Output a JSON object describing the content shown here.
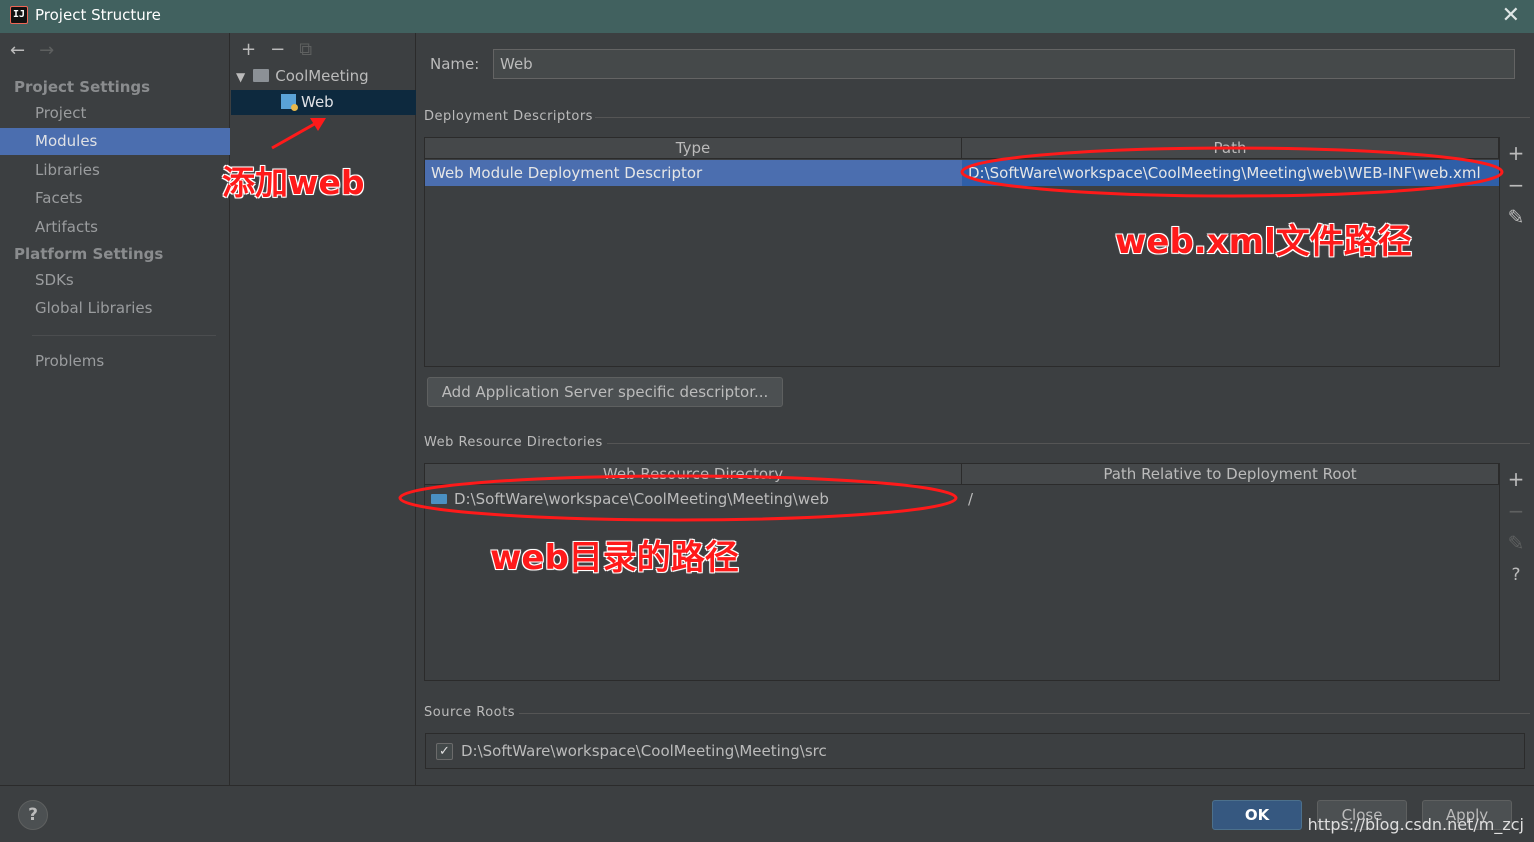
{
  "window": {
    "title": "Project Structure",
    "close_glyph": "✕",
    "app_icon_text": "IJ"
  },
  "nav": {
    "back": "←",
    "forward": "→"
  },
  "sidebar": {
    "project_settings_title": "Project Settings",
    "platform_settings_title": "Platform Settings",
    "items": [
      {
        "label": "Project"
      },
      {
        "label": "Modules",
        "active": true
      },
      {
        "label": "Libraries"
      },
      {
        "label": "Facets"
      },
      {
        "label": "Artifacts"
      },
      {
        "label": "SDKs"
      },
      {
        "label": "Global Libraries"
      },
      {
        "label": "Problems"
      }
    ]
  },
  "tree": {
    "toolbar": {
      "add": "+",
      "remove": "−",
      "copy": "⧉"
    },
    "expander": "▼",
    "root": "CoolMeeting",
    "child": "Web"
  },
  "module": {
    "name_label": "Name:",
    "name_value": "Web"
  },
  "deployment": {
    "title": "Deployment Descriptors",
    "columns": [
      "Type",
      "Path"
    ],
    "rows": [
      {
        "type": "Web Module Deployment Descriptor",
        "path": "D:\\SoftWare\\workspace\\CoolMeeting\\Meeting\\web\\WEB-INF\\web.xml"
      }
    ],
    "add_server_button": "Add Application Server specific descriptor..."
  },
  "resources": {
    "title": "Web Resource Directories",
    "columns": [
      "Web Resource Directory",
      "Path Relative to Deployment Root"
    ],
    "rows": [
      {
        "dir": "D:\\SoftWare\\workspace\\CoolMeeting\\Meeting\\web",
        "rel": "/"
      }
    ]
  },
  "side_tools": {
    "add": "+",
    "remove": "−",
    "edit": "✎",
    "help": "?"
  },
  "sources": {
    "title": "Source Roots",
    "check_glyph": "✓",
    "path": "D:\\SoftWare\\workspace\\CoolMeeting\\Meeting\\src"
  },
  "footer": {
    "help": "?",
    "ok": "OK",
    "close": "Close",
    "apply": "Apply",
    "watermark": "https://blog.csdn.net/m_zcj"
  },
  "annotations": {
    "add_web": "添加web",
    "web_xml_path": "web.xml文件路径",
    "web_dir_path": "web目录的路径"
  },
  "colors": {
    "annotation": "#ff1a1a",
    "selection": "#4b6eaf",
    "titlebar": "#41615f"
  }
}
